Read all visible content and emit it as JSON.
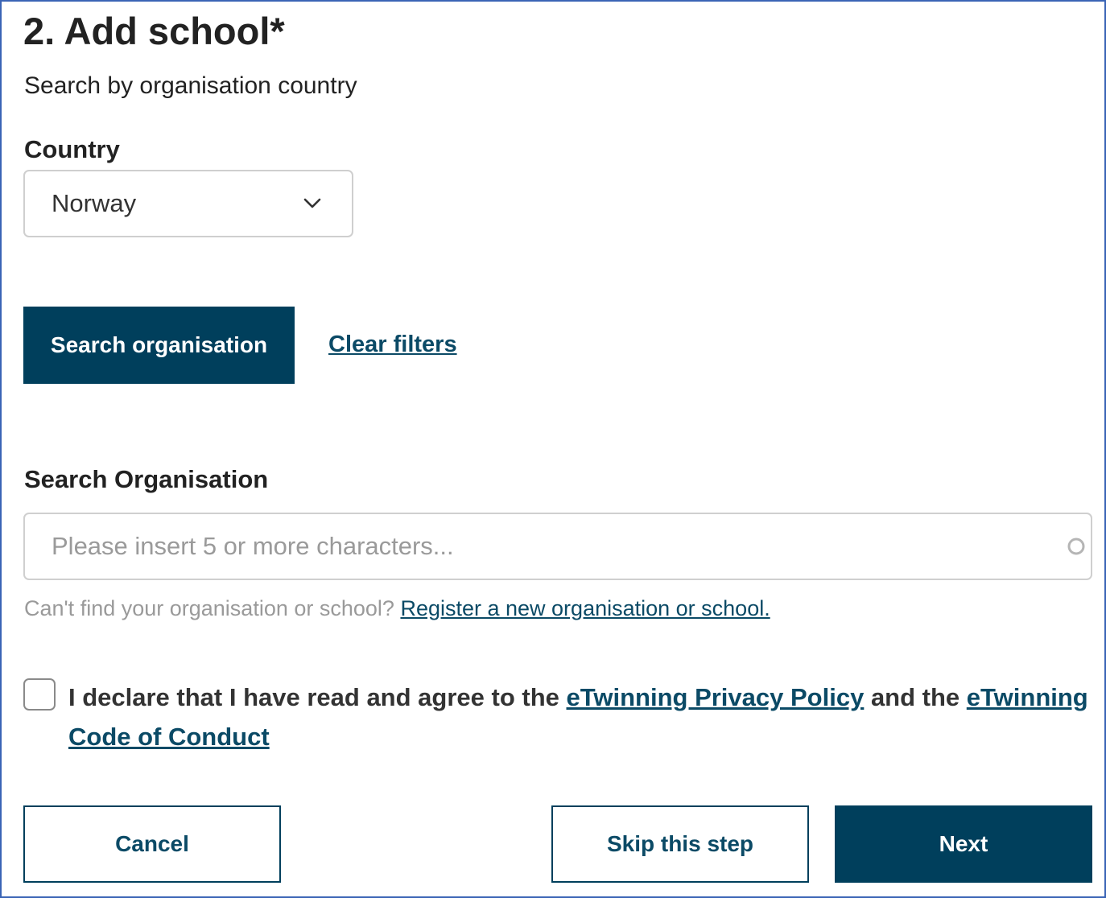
{
  "section": {
    "title": "2. Add school*",
    "subtitle": "Search by organisation country"
  },
  "country": {
    "label": "Country",
    "selected": "Norway",
    "icon": "chevron-down-icon"
  },
  "filters": {
    "search_button": "Search organisation",
    "clear_link": "Clear filters"
  },
  "organisation": {
    "label": "Search Organisation",
    "placeholder": "Please insert 5 or more characters...",
    "value": "",
    "loading_icon": "spinner-icon"
  },
  "help": {
    "text": "Can't find your organisation or school?",
    "link": "Register a new organisation or school."
  },
  "declaration": {
    "checked": false,
    "text_before": "I declare that I have read and agree to the ",
    "privacy_link": "eTwinning Privacy Policy",
    "text_middle": " and the ",
    "conduct_link": "eTwinning Code of Conduct"
  },
  "actions": {
    "cancel": "Cancel",
    "skip": "Skip this step",
    "next": "Next"
  },
  "colors": {
    "primary": "#003f5c",
    "link": "#0b4a66",
    "border": "#cfcfcf",
    "muted_text": "#9a9a9a",
    "frame": "#3a64b5"
  }
}
